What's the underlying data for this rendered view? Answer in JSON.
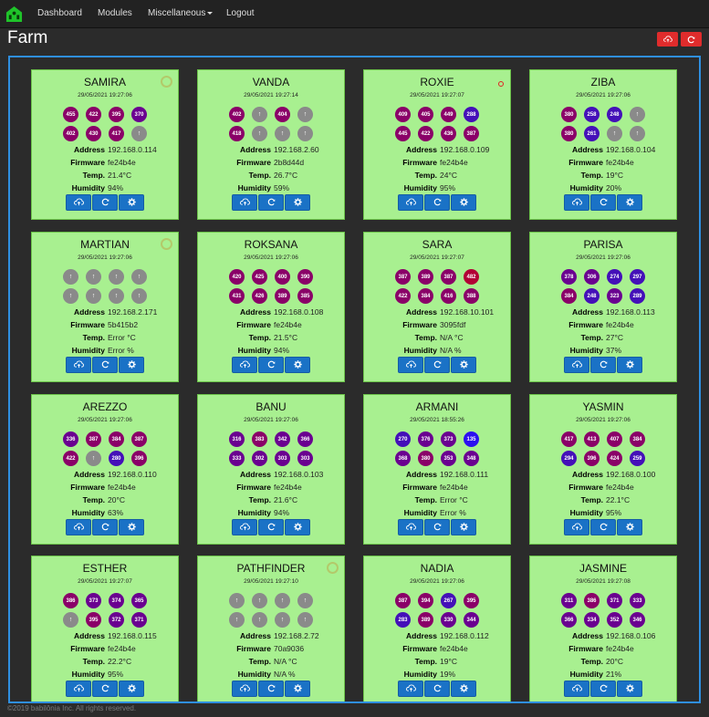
{
  "nav": {
    "logo_icon": "greenhouse-logo-icon",
    "links": [
      "Dashboard",
      "Modules",
      "Miscellaneous"
    ],
    "logout": "Logout"
  },
  "page": {
    "title": "Farm"
  },
  "header_actions": [
    {
      "icon": "cloud-upload-icon"
    },
    {
      "icon": "refresh-icon"
    }
  ],
  "labels": {
    "address": "Address",
    "firmware": "Firmware",
    "temp": "Temp.",
    "humidity": "Humidity"
  },
  "colors": {
    "card_bg": "#a8f090",
    "button_blue": "#1a72c6",
    "danger": "#e02c2c",
    "panel_border": "#2f8fe0"
  },
  "cards": [
    {
      "name": "SAMIRA",
      "date": "29/05/2021 19:27:06",
      "status": "ring",
      "address": "192.168.0.114",
      "firmware": "fe24b4e",
      "temp": "21.4°C",
      "humidity": "94%",
      "sensors": [
        "455",
        "422",
        "395",
        "370",
        "402",
        "430",
        "417",
        "↑"
      ]
    },
    {
      "name": "VANDA",
      "date": "29/05/2021 19:27:14",
      "status": "none",
      "address": "192.168.2.60",
      "firmware": "2b8d44d",
      "temp": "26.7°C",
      "humidity": "59%",
      "sensors": [
        "402",
        "↑",
        "404",
        "↑",
        "418",
        "↑",
        "↑",
        "↑"
      ]
    },
    {
      "name": "ROXIE",
      "date": "29/05/2021 19:27:07",
      "status": "dot",
      "address": "192.168.0.109",
      "firmware": "fe24b4e",
      "temp": "24°C",
      "humidity": "95%",
      "sensors": [
        "409",
        "405",
        "449",
        "288",
        "445",
        "422",
        "436",
        "387"
      ]
    },
    {
      "name": "ZIBA",
      "date": "29/05/2021 19:27:06",
      "status": "none",
      "address": "192.168.0.104",
      "firmware": "fe24b4e",
      "temp": "19°C",
      "humidity": "20%",
      "sensors": [
        "380",
        "258",
        "248",
        "↑",
        "380",
        "261",
        "↑",
        "↑"
      ]
    },
    {
      "name": "MARTIAN",
      "date": "29/05/2021 19:27:06",
      "status": "ring",
      "address": "192.168.2.171",
      "firmware": "5b415b2",
      "temp": "Error °C",
      "humidity": "Error %",
      "sensors": [
        "↑",
        "↑",
        "↑",
        "↑",
        "↑",
        "↑",
        "↑",
        "↑"
      ]
    },
    {
      "name": "ROKSANA",
      "date": "29/05/2021 19:27:06",
      "status": "none",
      "address": "192.168.0.108",
      "firmware": "fe24b4e",
      "temp": "21.5°C",
      "humidity": "94%",
      "sensors": [
        "420",
        "425",
        "400",
        "390",
        "431",
        "426",
        "389",
        "385"
      ]
    },
    {
      "name": "SARA",
      "date": "29/05/2021 19:27:07",
      "status": "none",
      "address": "192.168.10.101",
      "firmware": "3095fdf",
      "temp": "N/A °C",
      "humidity": "N/A %",
      "sensors": [
        "387",
        "389",
        "387",
        "482",
        "422",
        "384",
        "416",
        "388"
      ]
    },
    {
      "name": "PARISA",
      "date": "29/05/2021 19:27:06",
      "status": "none",
      "address": "192.168.0.113",
      "firmware": "fe24b4e",
      "temp": "27°C",
      "humidity": "37%",
      "sensors": [
        "378",
        "306",
        "274",
        "297",
        "384",
        "248",
        "323",
        "289"
      ]
    },
    {
      "name": "AREZZO",
      "date": "29/05/2021 19:27:06",
      "status": "none",
      "address": "192.168.0.110",
      "firmware": "fe24b4e",
      "temp": "20°C",
      "humidity": "63%",
      "sensors": [
        "336",
        "387",
        "384",
        "387",
        "422",
        "↑",
        "280",
        "396"
      ]
    },
    {
      "name": "BANU",
      "date": "29/05/2021 19:27:06",
      "status": "none",
      "address": "192.168.0.103",
      "firmware": "fe24b4e",
      "temp": "21.6°C",
      "humidity": "94%",
      "sensors": [
        "316",
        "383",
        "342",
        "366",
        "333",
        "302",
        "303",
        "303"
      ]
    },
    {
      "name": "ARMANI",
      "date": "29/05/2021 18:55:26",
      "status": "none",
      "address": "192.168.0.111",
      "firmware": "fe24b4e",
      "temp": "Error °C",
      "humidity": "Error %",
      "sensors": [
        "270",
        "376",
        "373",
        "135",
        "368",
        "380",
        "353",
        "348"
      ]
    },
    {
      "name": "YASMIN",
      "date": "29/05/2021 19:27:06",
      "status": "none",
      "address": "192.168.0.100",
      "firmware": "fe24b4e",
      "temp": "22.1°C",
      "humidity": "95%",
      "sensors": [
        "417",
        "413",
        "407",
        "384",
        "294",
        "396",
        "424",
        "259"
      ]
    },
    {
      "name": "ESTHER",
      "date": "29/05/2021 19:27:07",
      "status": "none",
      "address": "192.168.0.115",
      "firmware": "fe24b4e",
      "temp": "22.2°C",
      "humidity": "95%",
      "sensors": [
        "386",
        "373",
        "374",
        "365",
        "↑",
        "395",
        "372",
        "371"
      ]
    },
    {
      "name": "PATHFINDER",
      "date": "29/05/2021 19:27:10",
      "status": "ring",
      "address": "192.168.2.72",
      "firmware": "70a9036",
      "temp": "N/A °C",
      "humidity": "N/A %",
      "sensors": [
        "↑",
        "↑",
        "↑",
        "↑",
        "↑",
        "↑",
        "↑",
        "↑"
      ]
    },
    {
      "name": "NADIA",
      "date": "29/05/2021 19:27:06",
      "status": "none",
      "address": "192.168.0.112",
      "firmware": "fe24b4e",
      "temp": "19°C",
      "humidity": "19%",
      "sensors": [
        "387",
        "394",
        "267",
        "395",
        "283",
        "389",
        "330",
        "344"
      ]
    },
    {
      "name": "JASMINE",
      "date": "29/05/2021 19:27:08",
      "status": "none",
      "address": "192.168.0.106",
      "firmware": "fe24b4e",
      "temp": "20°C",
      "humidity": "21%",
      "sensors": [
        "311",
        "386",
        "371",
        "333",
        "366",
        "334",
        "352",
        "346"
      ]
    }
  ],
  "card_actions": [
    {
      "icon": "cloud-upload-icon"
    },
    {
      "icon": "refresh-icon"
    },
    {
      "icon": "gear-icon"
    }
  ],
  "footer": {
    "text": "©2019 babilônia Inc. All rights reserved."
  }
}
